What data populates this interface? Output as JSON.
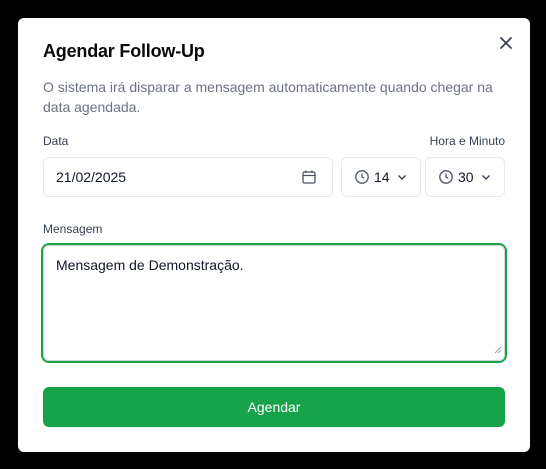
{
  "dialog": {
    "title": "Agendar Follow-Up",
    "description": "O sistema irá disparar a mensagem automaticamente quando chegar na data agendada."
  },
  "date": {
    "label": "Data",
    "value": "21/02/2025",
    "icon": "calendar-icon"
  },
  "time": {
    "label": "Hora e Minuto",
    "hour": "14",
    "minute": "30",
    "icon": "clock-icon"
  },
  "message": {
    "label": "Mensagem",
    "value": "Mensagem de Demonstração."
  },
  "submit_label": "Agendar",
  "colors": {
    "accent": "#16a34a",
    "overlay": "#000000",
    "muted_text": "#6b7280"
  }
}
